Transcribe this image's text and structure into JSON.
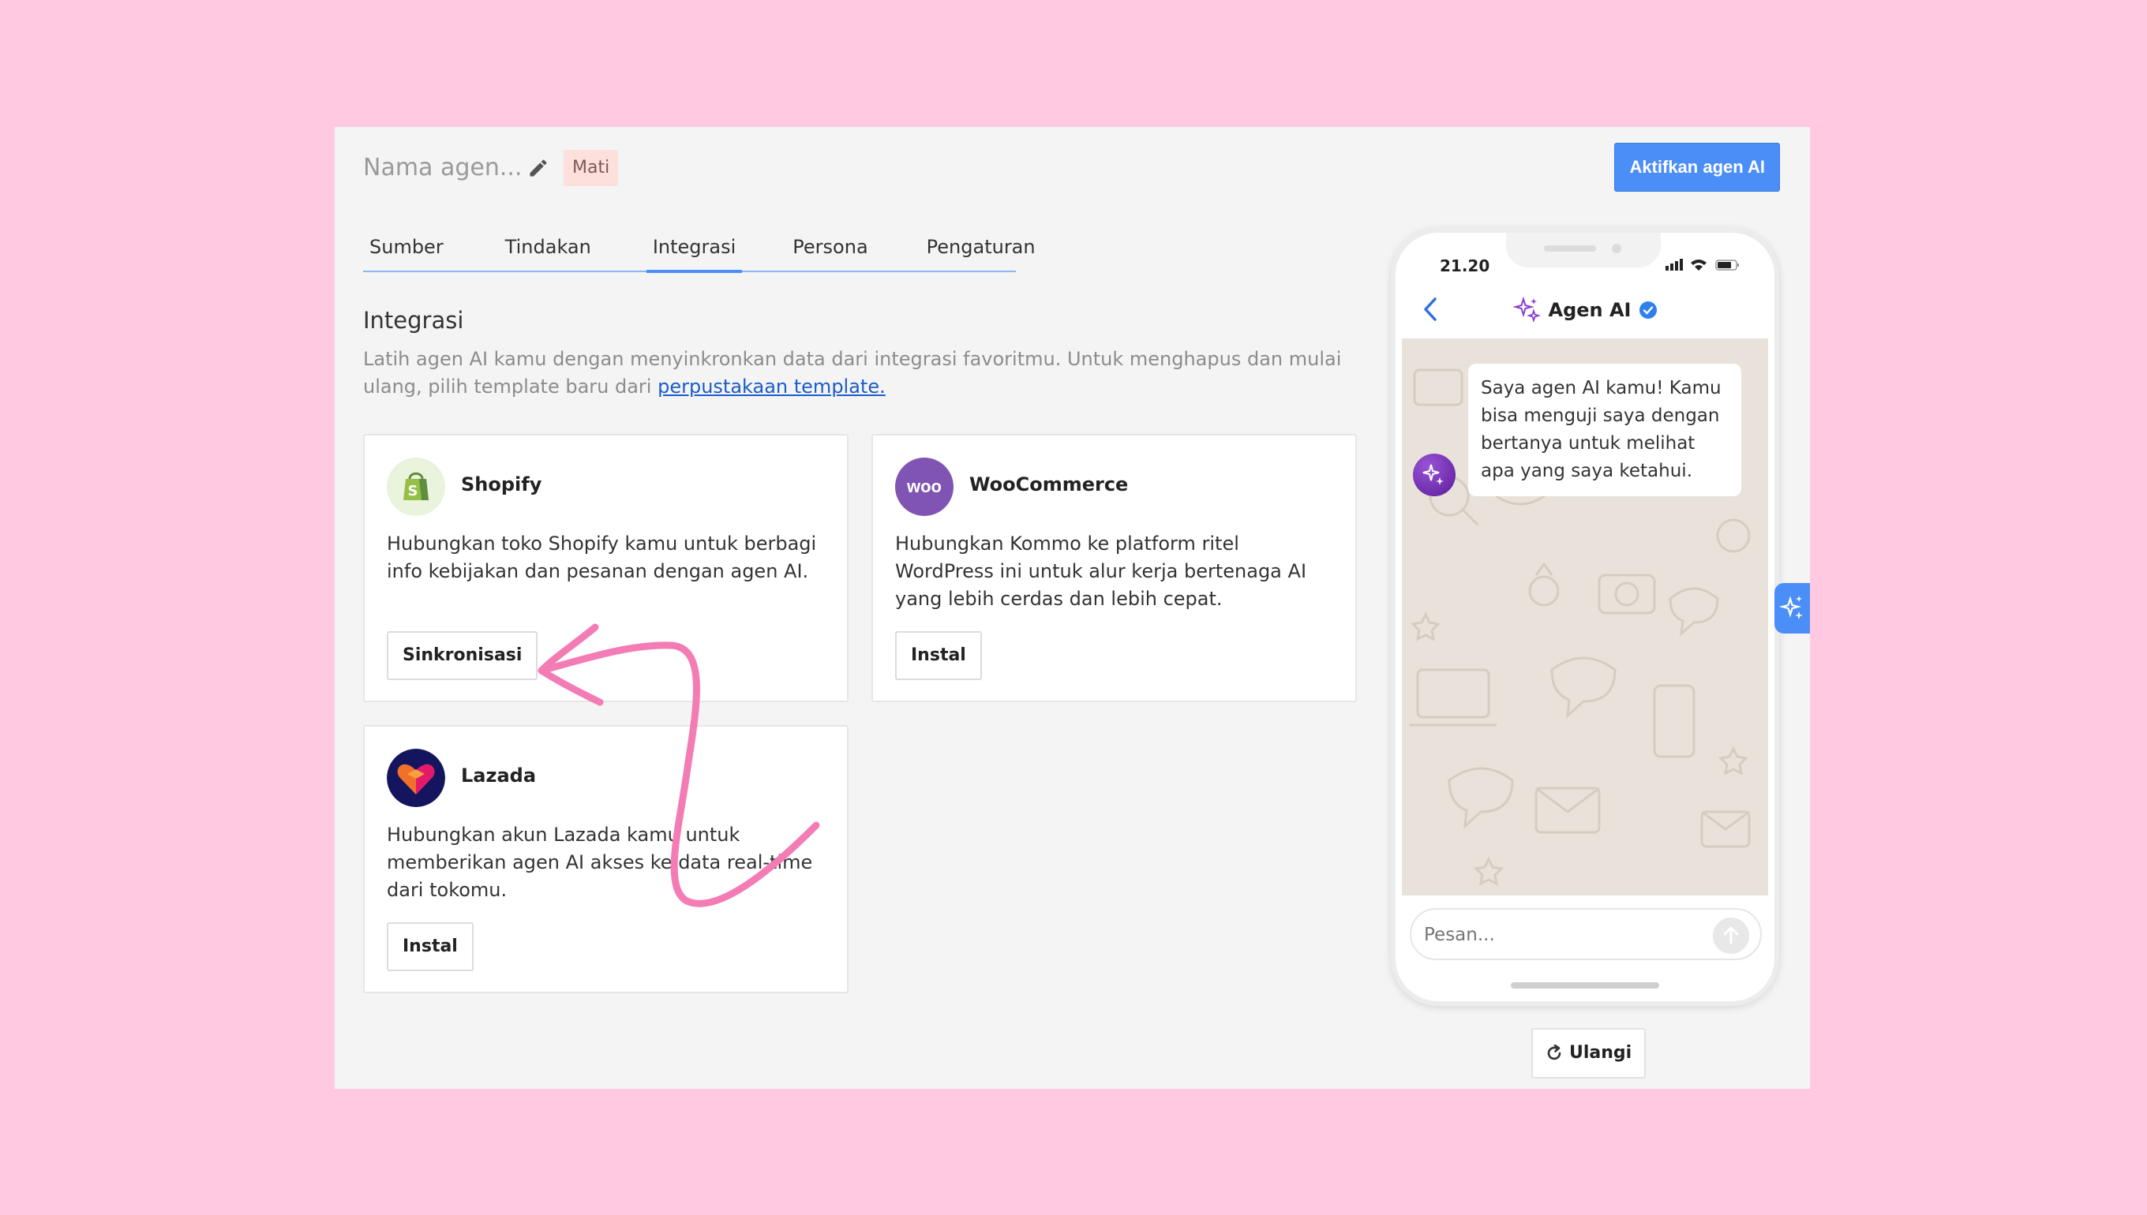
{
  "header": {
    "agent_name_placeholder": "Nama agen...",
    "status": "Mati",
    "activate_button": "Aktifkan agen AI"
  },
  "tabs": [
    {
      "label": "Sumber",
      "active": false
    },
    {
      "label": "Tindakan",
      "active": false
    },
    {
      "label": "Integrasi",
      "active": true
    },
    {
      "label": "Persona",
      "active": false
    },
    {
      "label": "Pengaturan",
      "active": false
    }
  ],
  "section": {
    "title": "Integrasi",
    "description": "Latih agen AI kamu dengan menyinkronkan data dari integrasi favoritmu. Untuk menghapus dan mulai ulang, pilih template baru dari ",
    "link_text": "perpustakaan template."
  },
  "integrations": [
    {
      "name": "Shopify",
      "logo_icon": "shopify-bag-icon",
      "description": "Hubungkan toko Shopify kamu untuk berbagi info kebijakan dan pesanan dengan agen AI.",
      "button": "Sinkronisasi"
    },
    {
      "name": "WooCommerce",
      "logo_icon": "woo-logo-icon",
      "logo_text": "woo",
      "description": "Hubungkan Kommo ke platform ritel WordPress ini untuk alur kerja bertenaga AI yang lebih cerdas dan lebih cepat.",
      "button": "Instal"
    },
    {
      "name": "Lazada",
      "logo_icon": "lazada-heart-icon",
      "description": "Hubungkan akun Lazada kamu untuk memberikan agen AI akses ke data real-time dari tokomu.",
      "button": "Instal"
    }
  ],
  "phone": {
    "time": "21.20",
    "chat_title": "Agen AI",
    "bot_message": "Saya agen AI kamu! Kamu bisa menguji saya dengan bertanya untuk melihat apa yang saya ketahui.",
    "composer_placeholder": "Pesan..."
  },
  "reset_button": "Ulangi",
  "colors": {
    "background": "#ffc9e1",
    "accent": "#4c8ef7",
    "annotation_arrow": "#f47cb5"
  }
}
